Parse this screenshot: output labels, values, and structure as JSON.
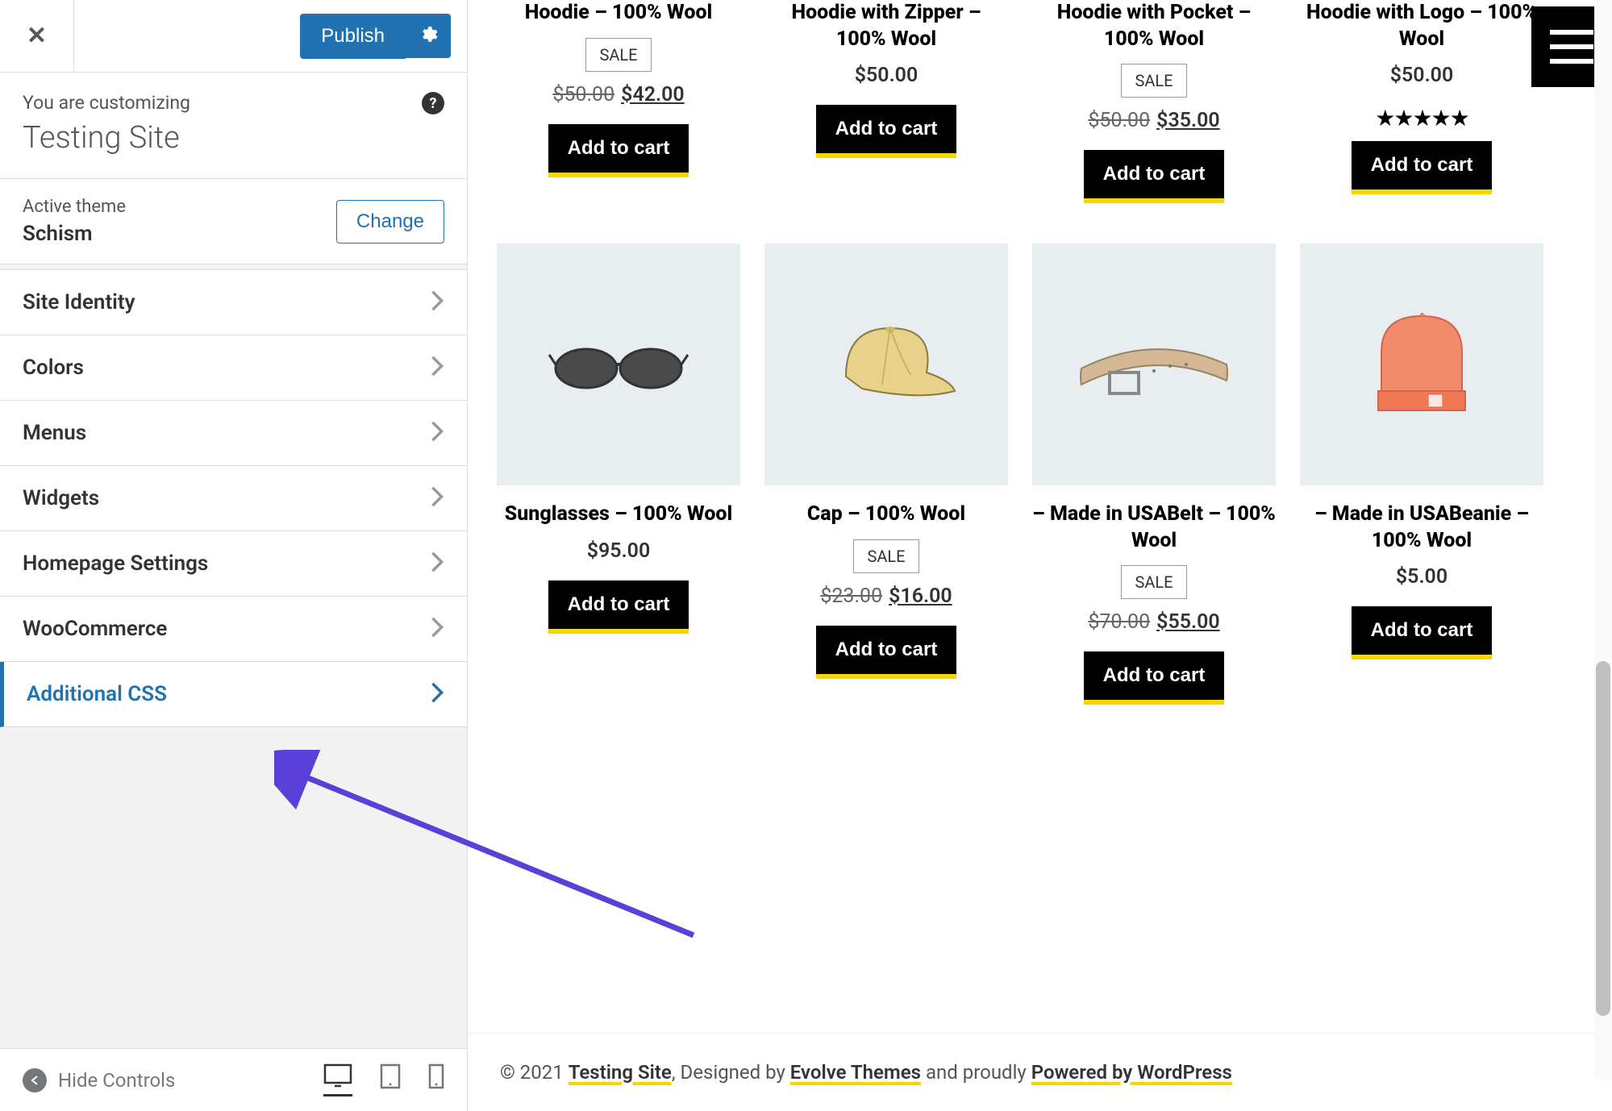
{
  "sidebar": {
    "publish_label": "Publish",
    "customizing_label": "You are customizing",
    "site_name": "Testing Site",
    "active_theme_label": "Active theme",
    "theme_name": "Schism",
    "change_label": "Change",
    "menu_items": [
      {
        "label": "Site Identity"
      },
      {
        "label": "Colors"
      },
      {
        "label": "Menus"
      },
      {
        "label": "Widgets"
      },
      {
        "label": "Homepage Settings"
      },
      {
        "label": "WooCommerce"
      },
      {
        "label": "Additional CSS"
      }
    ],
    "hide_controls_label": "Hide Controls"
  },
  "products_row1": [
    {
      "title": "Hoodie – 100% Wool",
      "sale": "SALE",
      "old_price": "$50.00",
      "price": "$42.00",
      "button": "Add to cart"
    },
    {
      "title": "Hoodie with Zipper – 100% Wool",
      "price": "$50.00",
      "button": "Add to cart"
    },
    {
      "title": "Hoodie with Pocket – 100% Wool",
      "sale": "SALE",
      "old_price": "$50.00",
      "price": "$35.00",
      "button": "Add to cart"
    },
    {
      "title": "Hoodie with Logo – 100% Wool",
      "price": "$50.00",
      "stars": "★★★★★",
      "button": "Add to cart"
    }
  ],
  "products_row2": [
    {
      "title": "Sunglasses – 100% Wool",
      "price": "$95.00",
      "button": "Add to cart",
      "img": "sunglasses"
    },
    {
      "title": "Cap – 100% Wool",
      "sale": "SALE",
      "old_price": "$23.00",
      "price": "$16.00",
      "button": "Add to cart",
      "img": "cap"
    },
    {
      "title": "– Made in USABelt – 100% Wool",
      "sale": "SALE",
      "old_price": "$70.00",
      "price": "$55.00",
      "button": "Add to cart",
      "img": "belt"
    },
    {
      "title": "– Made in USABeanie – 100% Wool",
      "price": "$5.00",
      "button": "Add to cart",
      "img": "beanie"
    }
  ],
  "footer": {
    "copyright": "© 2021 ",
    "site_link": "Testing Site",
    "designed_by": ", Designed by ",
    "theme_link": "Evolve Themes",
    "proudly": " and proudly ",
    "powered_link": "Powered by WordPress"
  }
}
